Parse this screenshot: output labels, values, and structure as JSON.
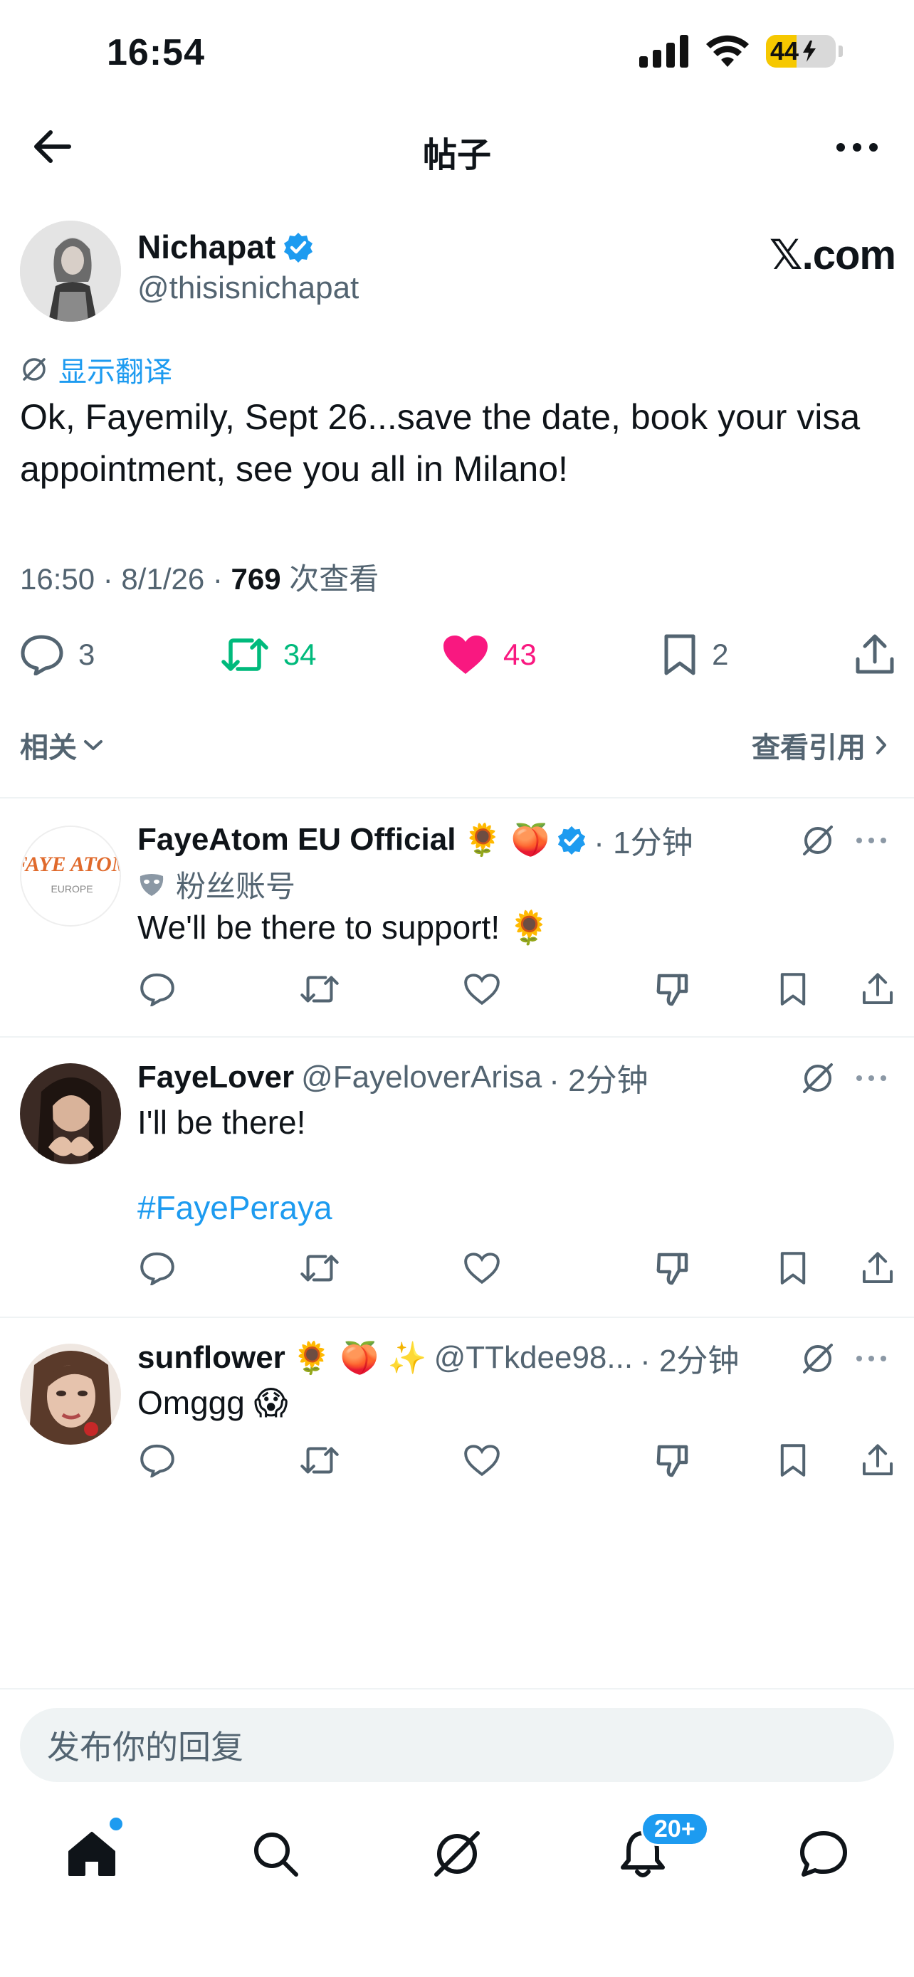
{
  "status": {
    "time": "16:54",
    "battery": "44"
  },
  "header": {
    "title": "帖子"
  },
  "post": {
    "name": "Nichapat",
    "handle": "@thisisnichapat",
    "source_logo": "𝕏.com",
    "translate": "显示翻译",
    "text": "Ok, Fayemily, Sept 26...save the date, book your visa appointment, see you all in Milano!",
    "time": "16:50 · 8/1/26 · ",
    "views_count": "769",
    "views_label": " 次查看",
    "replies": "3",
    "retweets": "34",
    "likes": "43",
    "bookmarks": "2",
    "related": "相关",
    "quotes": "查看引用"
  },
  "replies": [
    {
      "name": "FayeAtom EU Official",
      "emojis": "🌻 🍑",
      "time": "· 1分钟",
      "fan_label": "粉丝账号",
      "text": "We'll be there to support! 🌻",
      "avatar_text": "FAYE ATOM",
      "avatar_sub": "EUROPE"
    },
    {
      "name": "FayeLover",
      "handle": "@FayeloverArisa",
      "time": "· 2分钟",
      "text": "I'll be there!",
      "hashtag": "#FayePeraya"
    },
    {
      "name": "sunflower",
      "emojis": "🌻 🍑 ✨",
      "handle": "@TTkdee98...",
      "time": "· 2分钟",
      "text": "Omggg 😱"
    }
  ],
  "compose": {
    "placeholder": "发布你的回复"
  },
  "tabbar": {
    "notif_badge": "20+"
  },
  "colors": {
    "accent": "#1d9bf0",
    "retweet": "#00ba7c",
    "like": "#f91880",
    "battery": "#f6c800"
  }
}
